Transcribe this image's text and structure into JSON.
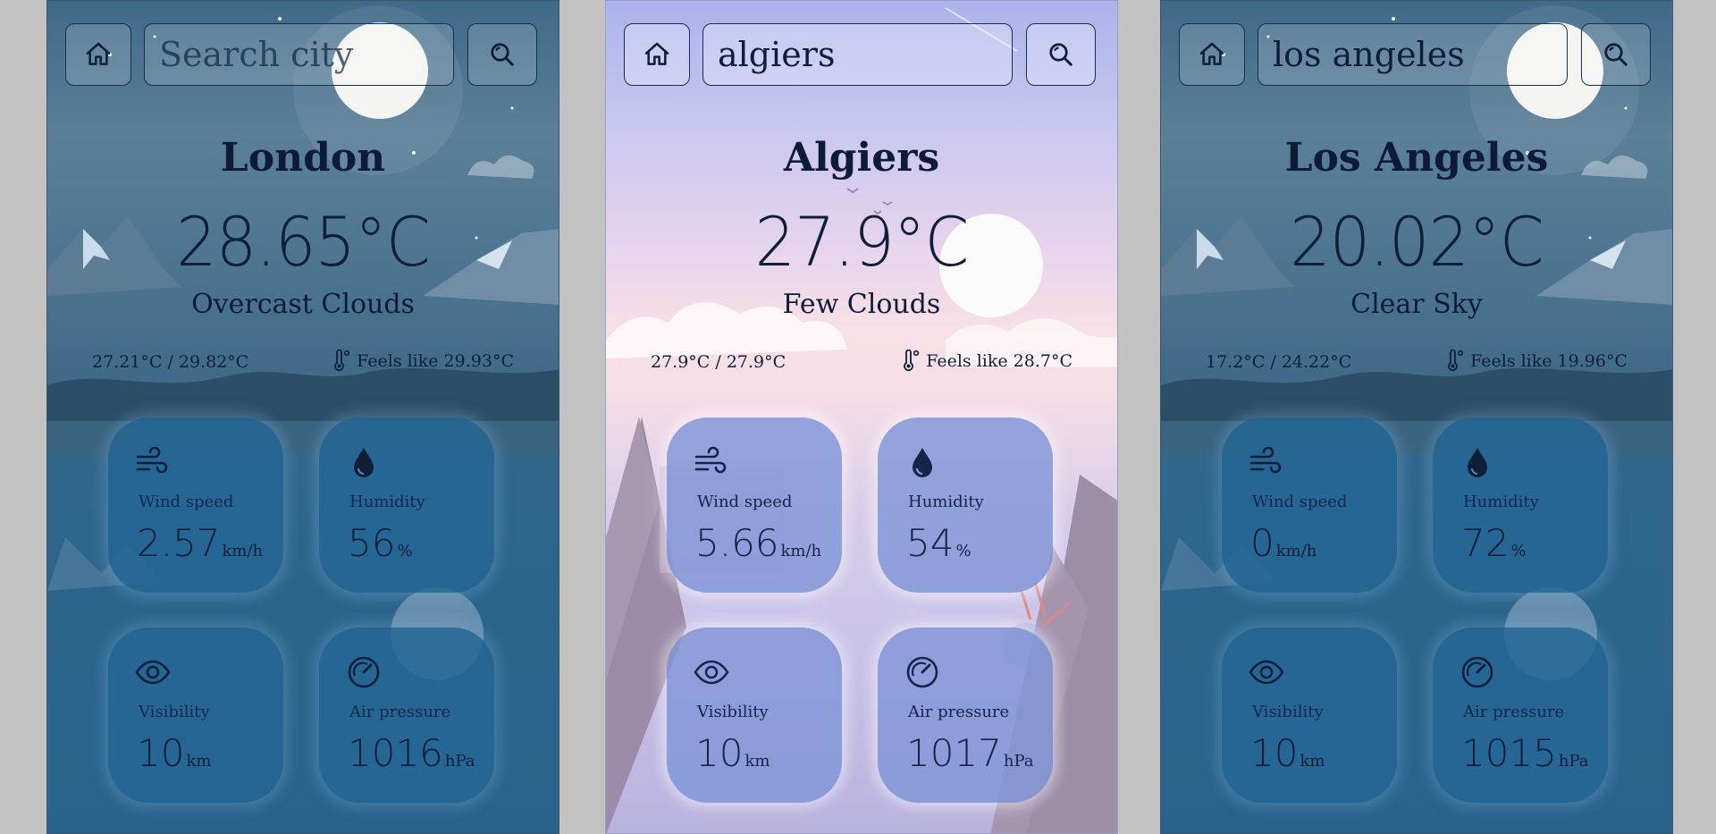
{
  "panels": [
    {
      "theme": "night",
      "search": {
        "value": "",
        "placeholder": "Search city"
      },
      "icons": {
        "home": "home-icon",
        "search": "search-icon"
      },
      "city": "London",
      "temperature": "28.65°C",
      "condition": "Overcast Clouds",
      "min_max": "27.21°C / 29.82°C",
      "feels_like": "Feels like 29.93°C",
      "stats": [
        {
          "label": "Wind speed",
          "value": "2.57",
          "unit": "km/h",
          "icon": "wind-icon"
        },
        {
          "label": "Humidity",
          "value": "56",
          "unit": "%",
          "icon": "water-drop-icon"
        },
        {
          "label": "Visibility",
          "value": "10",
          "unit": "km",
          "icon": "eye-icon"
        },
        {
          "label": "Air pressure",
          "value": "1016",
          "unit": "hPa",
          "icon": "gauge-icon"
        }
      ]
    },
    {
      "theme": "day",
      "search": {
        "value": "algiers",
        "placeholder": "Search city"
      },
      "icons": {
        "home": "home-icon",
        "search": "search-icon"
      },
      "city": "Algiers",
      "temperature": "27.9°C",
      "condition": "Few Clouds",
      "min_max": "27.9°C / 27.9°C",
      "feels_like": "Feels like 28.7°C",
      "stats": [
        {
          "label": "Wind speed",
          "value": "5.66",
          "unit": "km/h",
          "icon": "wind-icon"
        },
        {
          "label": "Humidity",
          "value": "54",
          "unit": "%",
          "icon": "water-drop-icon"
        },
        {
          "label": "Visibility",
          "value": "10",
          "unit": "km",
          "icon": "eye-icon"
        },
        {
          "label": "Air pressure",
          "value": "1017",
          "unit": "hPa",
          "icon": "gauge-icon"
        }
      ]
    },
    {
      "theme": "night",
      "search": {
        "value": "los angeles",
        "placeholder": "Search city"
      },
      "icons": {
        "home": "home-icon",
        "search": "search-icon"
      },
      "city": "Los Angeles",
      "temperature": "20.02°C",
      "condition": "Clear Sky",
      "min_max": "17.2°C / 24.22°C",
      "feels_like": "Feels like 19.96°C",
      "stats": [
        {
          "label": "Wind speed",
          "value": "0",
          "unit": "km/h",
          "icon": "wind-icon"
        },
        {
          "label": "Humidity",
          "value": "72",
          "unit": "%",
          "icon": "water-drop-icon"
        },
        {
          "label": "Visibility",
          "value": "10",
          "unit": "km",
          "icon": "eye-icon"
        },
        {
          "label": "Air pressure",
          "value": "1015",
          "unit": "hPa",
          "icon": "gauge-icon"
        }
      ]
    }
  ],
  "colors": {
    "page_background": "#c2c2c2",
    "night_sky": "#3f6a88",
    "day_sky": "#c7c6ef",
    "card_night": "#2466a0",
    "card_day": "#8096d8",
    "text_dark": "#0e1b38"
  }
}
